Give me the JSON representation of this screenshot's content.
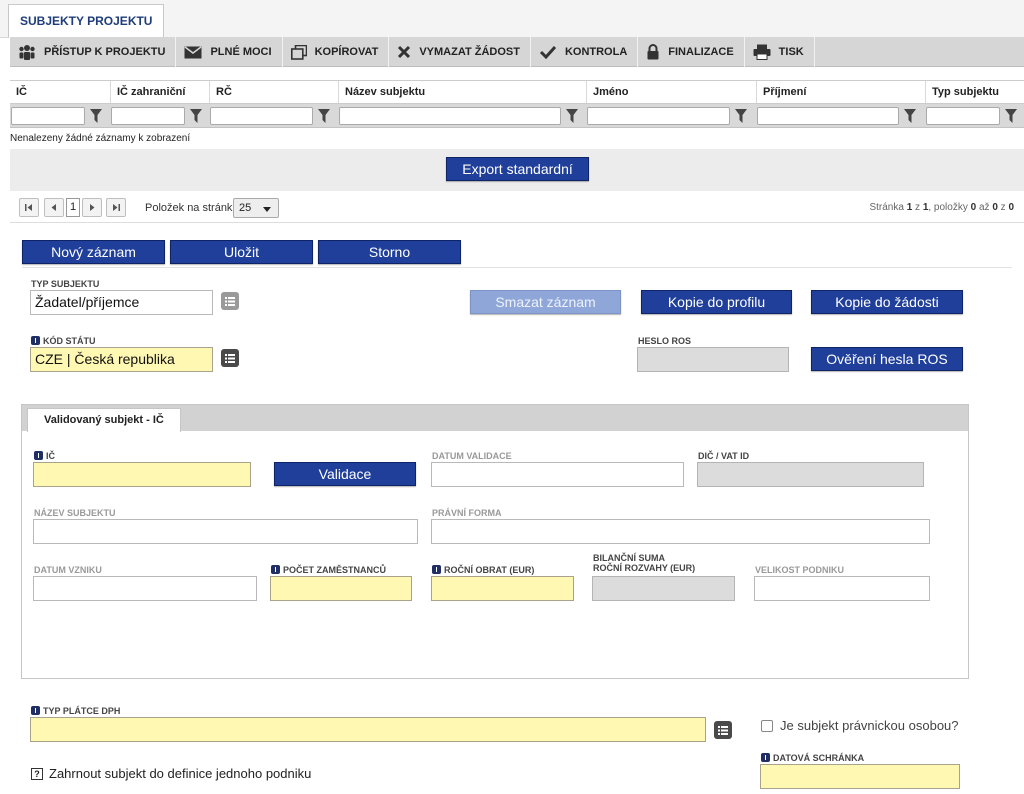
{
  "tabs": {
    "main": "SUBJEKTY PROJEKTU"
  },
  "toolbar": [
    {
      "icon": "users-icon",
      "label": "PŘÍSTUP K PROJEKTU"
    },
    {
      "icon": "envelope-icon",
      "label": "PLNÉ MOCI"
    },
    {
      "icon": "copy-icon",
      "label": "KOPÍROVAT"
    },
    {
      "icon": "close-icon",
      "label": "VYMAZAT ŽÁDOST"
    },
    {
      "icon": "check-icon",
      "label": "KONTROLA"
    },
    {
      "icon": "lock-icon",
      "label": "FINALIZACE"
    },
    {
      "icon": "printer-icon",
      "label": "TISK"
    }
  ],
  "grid": {
    "columns": [
      "IČ",
      "IČ zahraniční",
      "RČ",
      "Název subjektu",
      "Jméno",
      "Příjmení",
      "Typ subjektu"
    ],
    "empty_message": "Nenalezeny žádné záznamy k zobrazení"
  },
  "export": {
    "label": "Export standardní"
  },
  "pager": {
    "current_page": "1",
    "per_page_label": "Položek na stránku",
    "per_page_value": "25",
    "info_page_label": "Stránka",
    "info_page": "1",
    "info_of": "z",
    "info_total_pages": "1",
    "info_items_label": ", položky",
    "info_from": "0",
    "info_to_label": "až",
    "info_to": "0",
    "info_of2": "z",
    "info_total": "0"
  },
  "actions": {
    "new": "Nový záznam",
    "save": "Uložit",
    "cancel": "Storno"
  },
  "form": {
    "typ_subjektu": {
      "label": "TYP SUBJEKTU",
      "value": "Žadatel/příjemce"
    },
    "smazat": "Smazat záznam",
    "kopie_profil": "Kopie do profilu",
    "kopie_zadost": "Kopie do žádosti",
    "kod_statu": {
      "label": "KÓD STÁTU",
      "value": "CZE | Česká republika"
    },
    "heslo_ros": {
      "label": "HESLO ROS",
      "value": ""
    },
    "overeni": "Ověření hesla ROS"
  },
  "validated": {
    "tab": "Validovaný subjekt - IČ",
    "ic": {
      "label": "IČ",
      "value": ""
    },
    "validace": "Validace",
    "datum_validace": {
      "label": "DATUM VALIDACE",
      "value": ""
    },
    "dic": {
      "label": "DIČ / VAT ID",
      "value": ""
    },
    "nazev": {
      "label": "NÁZEV SUBJEKTU",
      "value": ""
    },
    "pravni_forma": {
      "label": "PRÁVNÍ FORMA",
      "value": ""
    },
    "datum_vzniku": {
      "label": "DATUM VZNIKU",
      "value": ""
    },
    "pocet_zam": {
      "label": "POČET ZAMĚSTNANCŮ",
      "value": ""
    },
    "rocni_obrat": {
      "label": "ROČNÍ OBRAT (EUR)",
      "value": ""
    },
    "bilancni_1": "BILANČNÍ SUMA",
    "bilancni_2": "ROČNÍ ROZVAHY (EUR)",
    "velikost": {
      "label": "VELIKOST PODNIKU",
      "value": ""
    }
  },
  "bottom": {
    "typ_platce": {
      "label": "TYP PLÁTCE DPH",
      "value": ""
    },
    "pravnicka": "Je subjekt právnickou osobou?",
    "zahrnout": "Zahrnout subjekt do definice jednoho podniku",
    "help_glyph": "?",
    "datova": {
      "label": "DATOVÁ SCHRÁNKA",
      "value": ""
    }
  },
  "colors": {
    "primary_button": "#1f3f9a",
    "required_field": "#fff8b3",
    "title": "#1f3d7a"
  }
}
